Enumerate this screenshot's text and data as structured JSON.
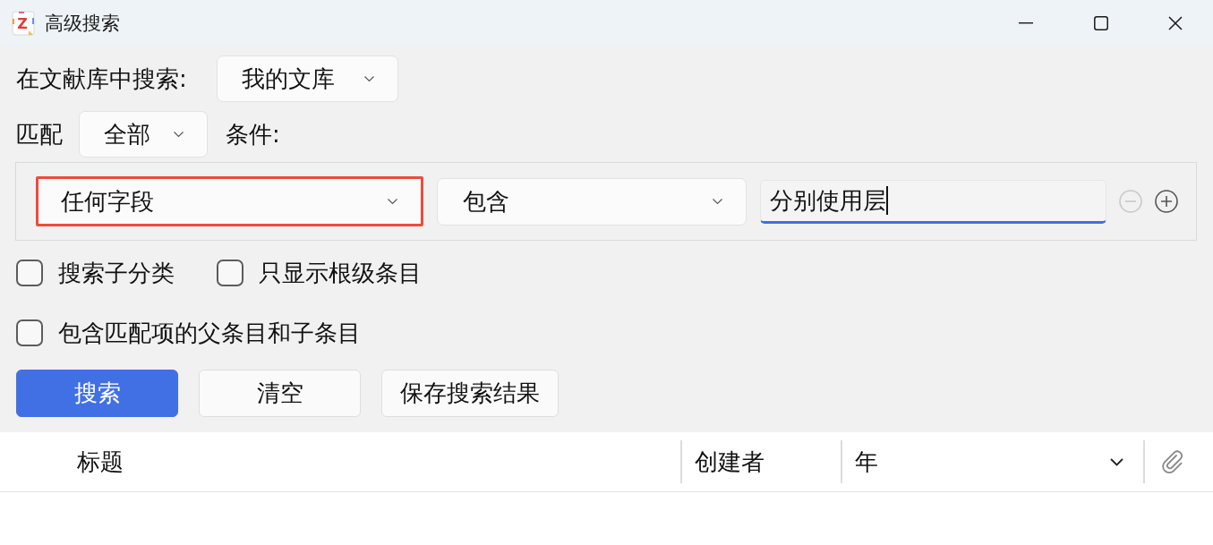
{
  "window": {
    "logo_text": "Z",
    "title": "高级搜索"
  },
  "scope": {
    "label": "在文献库中搜索:",
    "value": "我的文库"
  },
  "match": {
    "label": "匹配",
    "value": "全部",
    "conditions_label": "条件:"
  },
  "conditions": [
    {
      "field": "任何字段",
      "highlighted": true,
      "operator": "包含",
      "value": "分别使用层",
      "focused": true,
      "remove_disabled": true
    }
  ],
  "option_rows": [
    {
      "items": [
        {
          "label": "搜索子分类",
          "checked": false
        },
        {
          "label": "只显示根级条目",
          "checked": false
        }
      ]
    },
    {
      "items": [
        {
          "label": "包含匹配项的父条目和子条目",
          "checked": false
        }
      ]
    }
  ],
  "buttons": [
    {
      "label": "搜索",
      "kind": "primary"
    },
    {
      "label": "清空",
      "kind": "default"
    },
    {
      "label": "保存搜索结果",
      "kind": "default"
    }
  ],
  "table": {
    "columns": [
      {
        "kind": "text",
        "label": "标题",
        "sorted": false
      },
      {
        "kind": "text",
        "label": "创建者",
        "sorted": false
      },
      {
        "kind": "text",
        "label": "年",
        "sorted": true
      },
      {
        "kind": "attachment"
      }
    ]
  }
}
